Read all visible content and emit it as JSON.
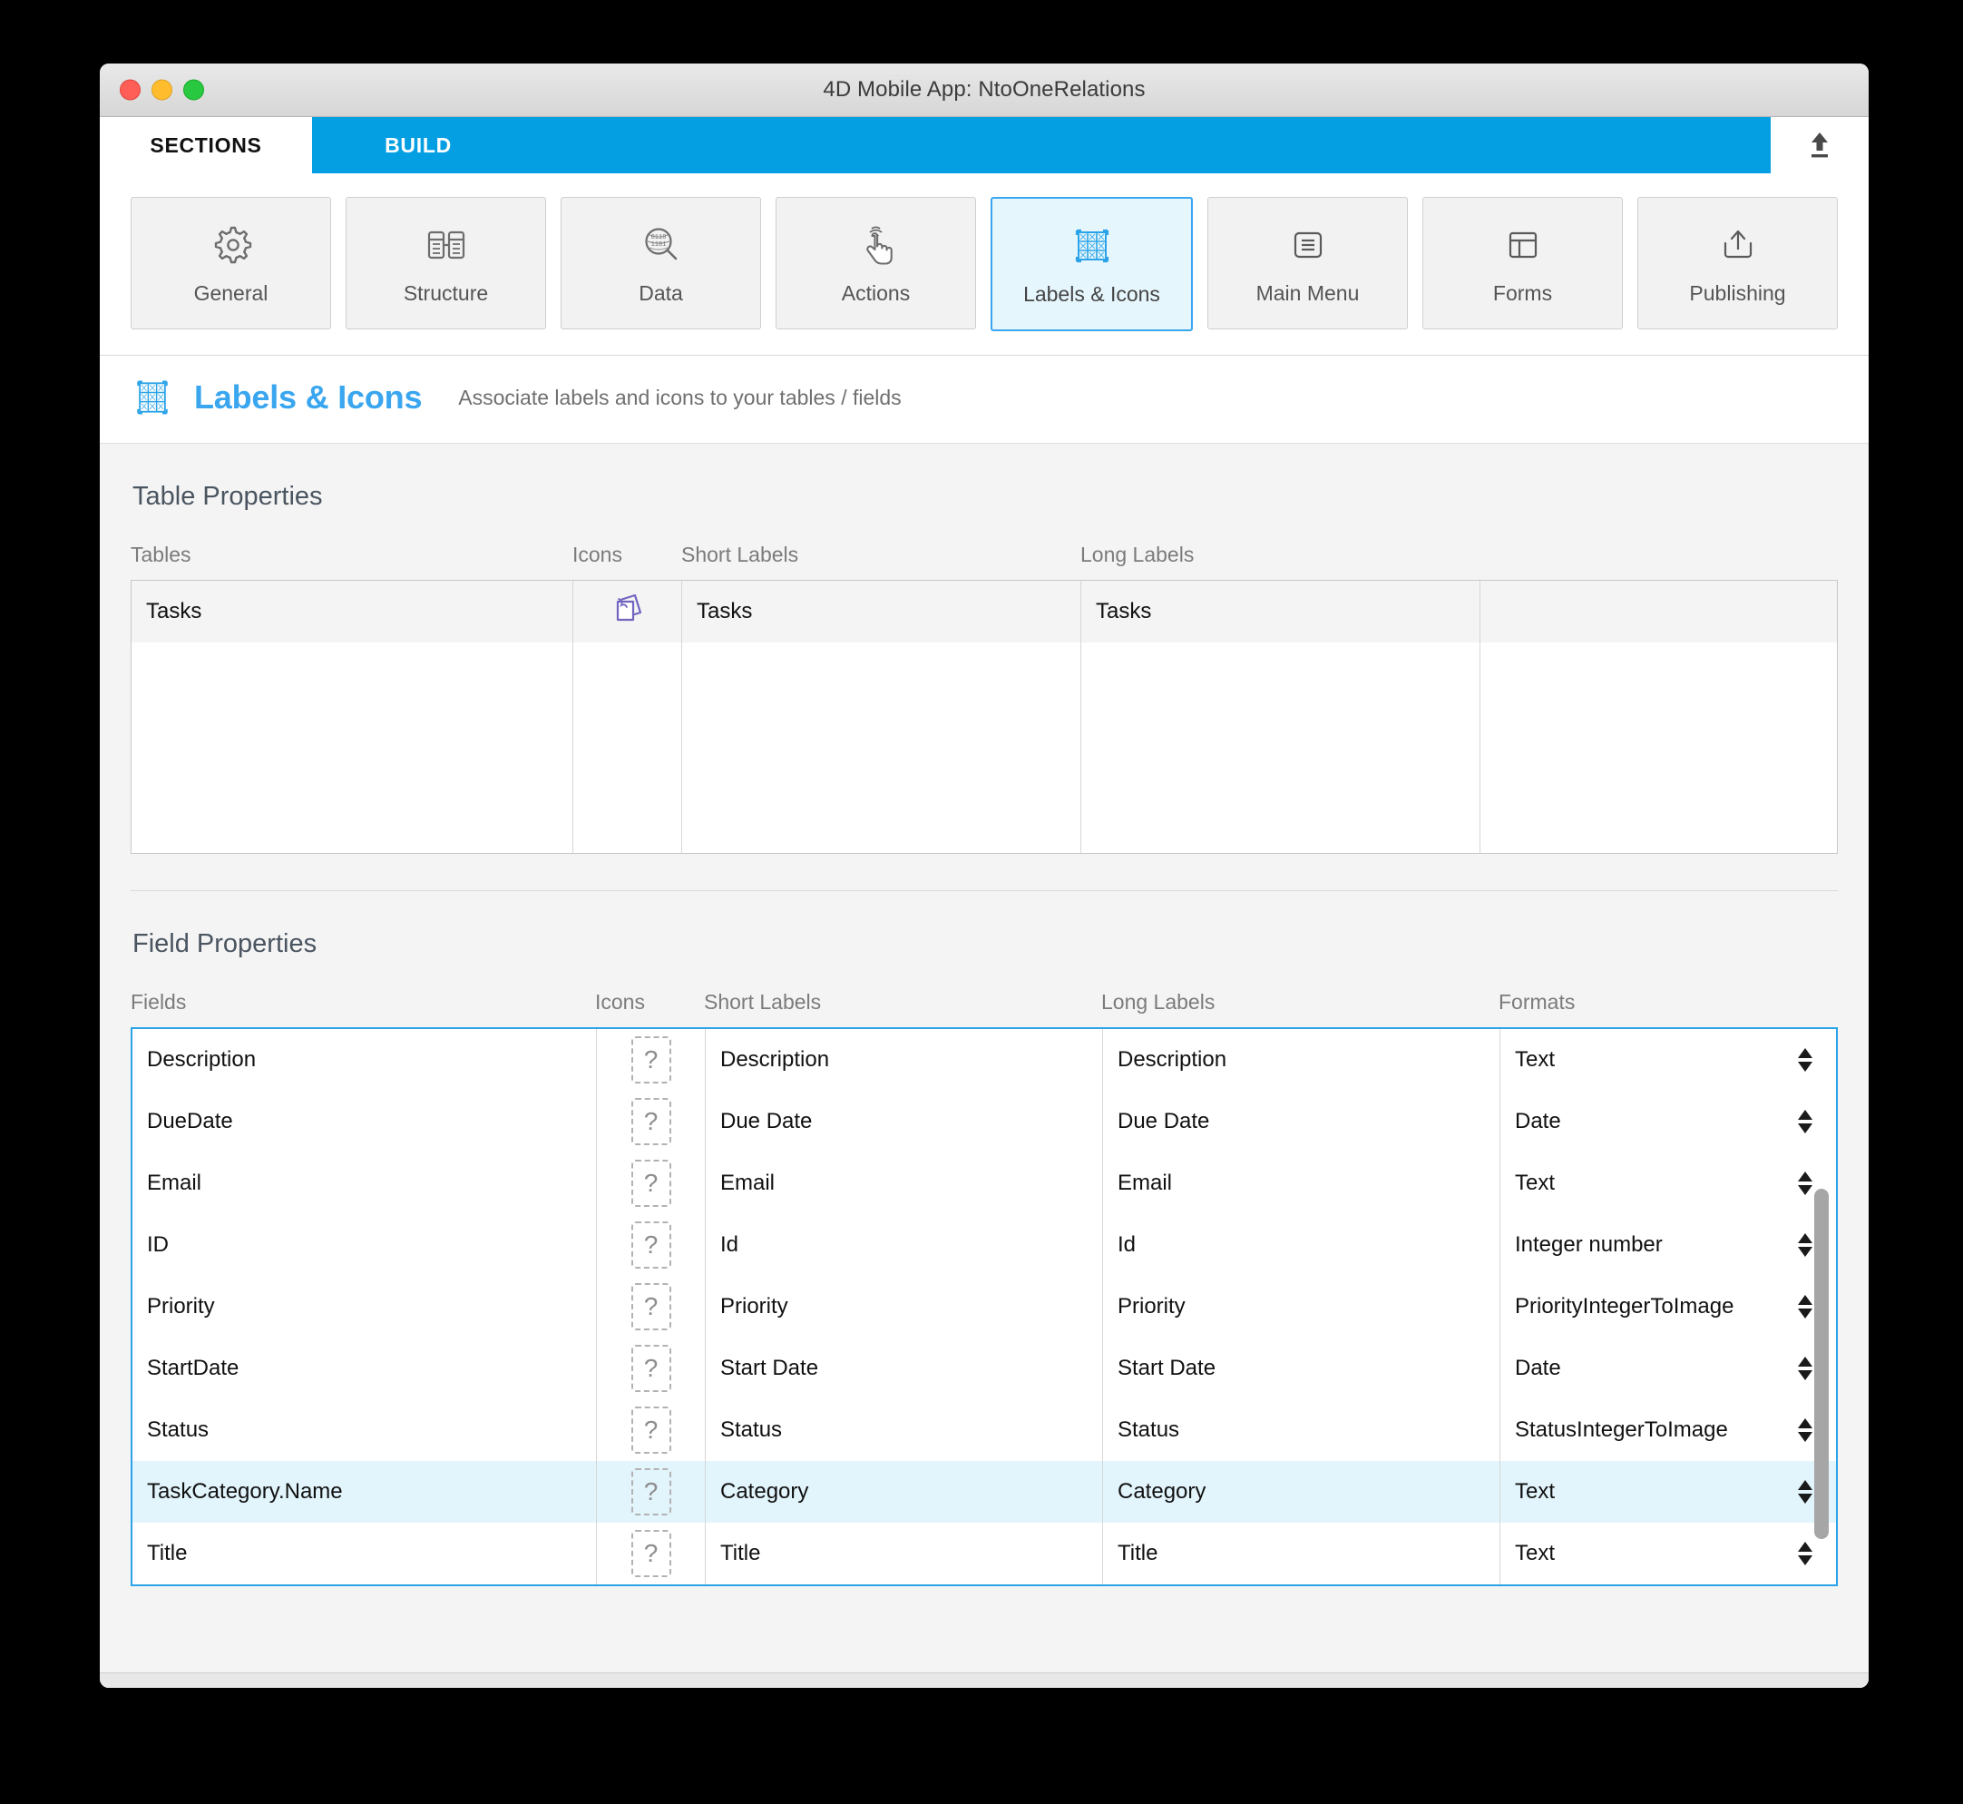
{
  "window": {
    "title": "4D Mobile App: NtoOneRelations",
    "traffic_lights": [
      "close",
      "minimize",
      "zoom"
    ]
  },
  "tabs": [
    {
      "label": "SECTIONS",
      "active": true
    },
    {
      "label": "BUILD",
      "active": false
    }
  ],
  "toolbar": {
    "upload_icon": "upload-icon",
    "buttons": [
      {
        "label": "General",
        "icon": "gear-icon",
        "selected": false
      },
      {
        "label": "Structure",
        "icon": "structure-icon",
        "selected": false
      },
      {
        "label": "Data",
        "icon": "data-search-icon",
        "selected": false
      },
      {
        "label": "Actions",
        "icon": "tap-hand-icon",
        "selected": false
      },
      {
        "label": "Labels & Icons",
        "icon": "labels-icons-icon",
        "selected": true
      },
      {
        "label": "Main Menu",
        "icon": "hamburger-icon",
        "selected": false
      },
      {
        "label": "Forms",
        "icon": "layout-icon",
        "selected": false
      },
      {
        "label": "Publishing",
        "icon": "publish-icon",
        "selected": false
      }
    ]
  },
  "page_header": {
    "icon": "labels-icons-icon",
    "title": "Labels & Icons",
    "subtitle": "Associate labels and icons to your tables / fields"
  },
  "table_properties": {
    "section_title": "Table Properties",
    "columns": [
      "Tables",
      "Icons",
      "Short Labels",
      "Long Labels",
      ""
    ],
    "rows": [
      {
        "name": "Tasks",
        "icon": "stacked-documents-icon",
        "short_label": "Tasks",
        "long_label": "Tasks",
        "extra": ""
      }
    ]
  },
  "field_properties": {
    "section_title": "Field Properties",
    "columns": [
      "Fields",
      "Icons",
      "Short Labels",
      "Long Labels",
      "Formats"
    ],
    "rows": [
      {
        "name": "Description",
        "icon": "question-placeholder-icon",
        "short_label": "Description",
        "long_label": "Description",
        "format": "Text",
        "selected": false
      },
      {
        "name": "DueDate",
        "icon": "question-placeholder-icon",
        "short_label": "Due Date",
        "long_label": "Due Date",
        "format": "Date",
        "selected": false
      },
      {
        "name": "Email",
        "icon": "question-placeholder-icon",
        "short_label": "Email",
        "long_label": "Email",
        "format": "Text",
        "selected": false
      },
      {
        "name": "ID",
        "icon": "question-placeholder-icon",
        "short_label": "Id",
        "long_label": "Id",
        "format": "Integer number",
        "selected": false
      },
      {
        "name": "Priority",
        "icon": "question-placeholder-icon",
        "short_label": "Priority",
        "long_label": "Priority",
        "format": "PriorityIntegerToImage",
        "selected": false
      },
      {
        "name": "StartDate",
        "icon": "question-placeholder-icon",
        "short_label": "Start Date",
        "long_label": "Start Date",
        "format": "Date",
        "selected": false
      },
      {
        "name": "Status",
        "icon": "question-placeholder-icon",
        "short_label": "Status",
        "long_label": "Status",
        "format": "StatusIntegerToImage",
        "selected": false
      },
      {
        "name": "TaskCategory.Name",
        "icon": "question-placeholder-icon",
        "short_label": "Category",
        "long_label": "Category",
        "format": "Text",
        "selected": true
      },
      {
        "name": "Title",
        "icon": "question-placeholder-icon",
        "short_label": "Title",
        "long_label": "Title",
        "format": "Text",
        "selected": false
      }
    ]
  },
  "colors": {
    "accent": "#049fe3",
    "selection": "#e2f4fc",
    "header_title": "#3aa6ef",
    "table_icon": "#7165c0",
    "window_bg": "#f4f4f5"
  },
  "icon_glyphs": {
    "question": "?"
  }
}
